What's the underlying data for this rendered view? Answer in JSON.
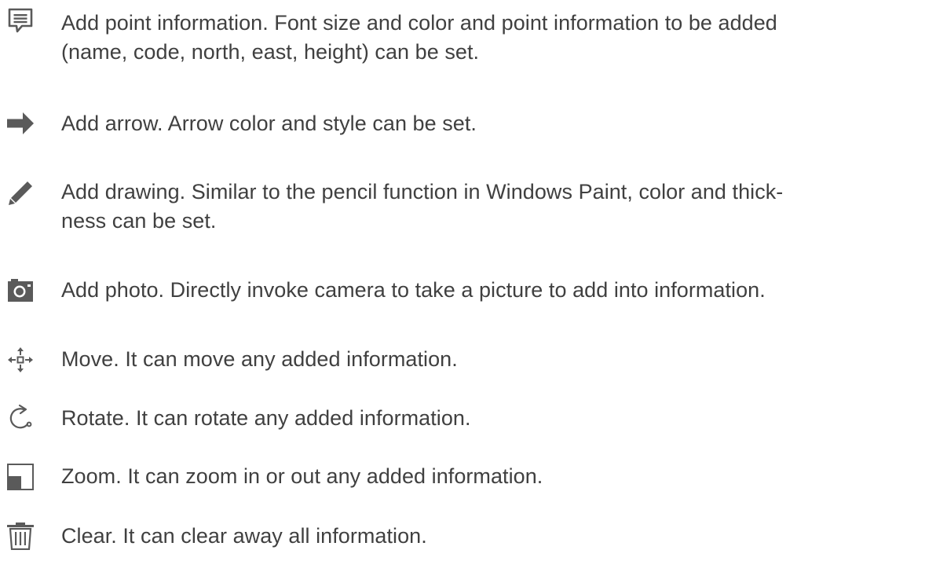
{
  "items": [
    {
      "icon": "annotation-icon",
      "line1": "Add point information. Font size and color and point information to be added",
      "line2": "(name, code, north, east, height) can be set."
    },
    {
      "icon": "arrow-right-icon",
      "line1": "Add arrow. Arrow color and style can be set."
    },
    {
      "icon": "pencil-icon",
      "line1": "Add drawing. Similar to the pencil function in Windows Paint, color and thick-",
      "line2": "ness can be set."
    },
    {
      "icon": "camera-icon",
      "line1": "Add photo. Directly invoke camera to take a picture to add into information."
    },
    {
      "icon": "move-icon",
      "line1": "Move. It can move any added information."
    },
    {
      "icon": "rotate-icon",
      "line1": "Rotate. It can rotate any added information."
    },
    {
      "icon": "zoom-icon",
      "line1": "Zoom. It can zoom in or out any added information."
    },
    {
      "icon": "trash-icon",
      "line1": "Clear. It can clear away all information."
    }
  ],
  "colors": {
    "text": "#404040",
    "icon": "#5a5a5a"
  }
}
